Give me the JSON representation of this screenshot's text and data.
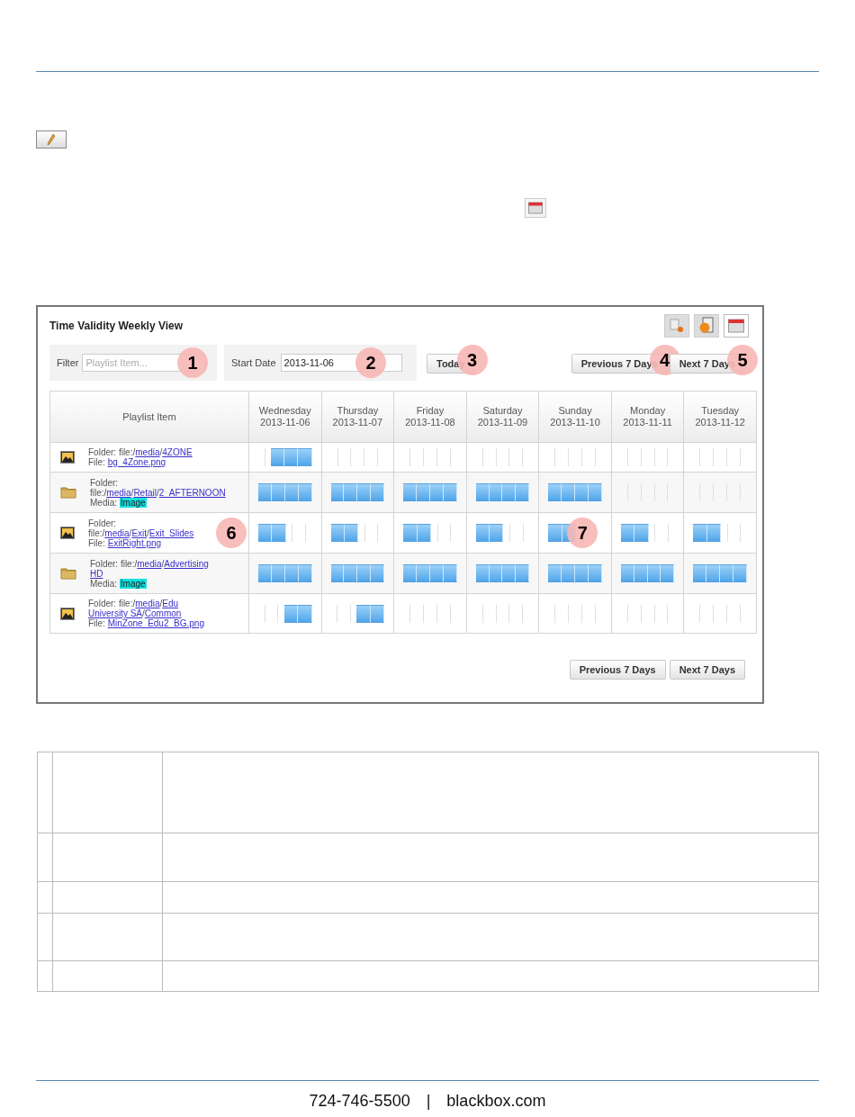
{
  "panel": {
    "title": "Time Validity Weekly View",
    "filter": {
      "label": "Filter",
      "placeholder": "Playlist Item...",
      "callout": "1"
    },
    "start_date": {
      "label": "Start Date",
      "value": "2013-11-06",
      "callout": "2"
    },
    "today_button": {
      "label": "Today",
      "callout": "3"
    },
    "top_nav": [
      {
        "label": "Previous 7 Days",
        "callout": "4"
      },
      {
        "label": "Next 7 Days",
        "callout": "5"
      }
    ],
    "table": {
      "first_column": "Playlist Item",
      "days": [
        {
          "day": "Wednesday",
          "date": "2013-11-06"
        },
        {
          "day": "Thursday",
          "date": "2013-11-07"
        },
        {
          "day": "Friday",
          "date": "2013-11-08"
        },
        {
          "day": "Saturday",
          "date": "2013-11-09"
        },
        {
          "day": "Sunday",
          "date": "2013-11-10"
        },
        {
          "day": "Monday",
          "date": "2013-11-11"
        },
        {
          "day": "Tuesday",
          "date": "2013-11-12"
        }
      ],
      "rows": [
        {
          "kind": "image",
          "lines": [
            [
              {
                "kind": "plain",
                "text": "Folder: file:/"
              },
              {
                "kind": "link",
                "text": "media"
              },
              {
                "kind": "plain",
                "text": "/"
              },
              {
                "kind": "link",
                "text": "4ZONE"
              }
            ],
            [
              {
                "kind": "plain",
                "text": "File: "
              },
              {
                "kind": "link",
                "text": "bg_4Zone.png"
              }
            ]
          ],
          "schedule": [
            {
              "slots": [
                false,
                true,
                true,
                true
              ]
            },
            {
              "slots": [
                false,
                false,
                false,
                false
              ]
            },
            {
              "slots": [
                false,
                false,
                false,
                false
              ]
            },
            {
              "slots": [
                false,
                false,
                false,
                false
              ]
            },
            {
              "slots": [
                false,
                false,
                false,
                false
              ]
            },
            {
              "slots": [
                false,
                false,
                false,
                false
              ]
            },
            {
              "slots": [
                false,
                false,
                false,
                false
              ]
            }
          ]
        },
        {
          "kind": "folder",
          "lines": [
            [
              {
                "kind": "plain",
                "text": "Folder:"
              }
            ],
            [
              {
                "kind": "plain",
                "text": "file:/"
              },
              {
                "kind": "link",
                "text": "media"
              },
              {
                "kind": "plain",
                "text": "/"
              },
              {
                "kind": "link",
                "text": "Retail"
              },
              {
                "kind": "plain",
                "text": "/"
              },
              {
                "kind": "link",
                "text": "2_AFTERNOON"
              }
            ],
            [
              {
                "kind": "plain",
                "text": "Media: "
              },
              {
                "kind": "tag",
                "text": "Image"
              }
            ]
          ],
          "schedule": [
            {
              "slots": [
                true,
                true,
                true,
                true
              ]
            },
            {
              "slots": [
                true,
                true,
                true,
                true
              ]
            },
            {
              "slots": [
                true,
                true,
                true,
                true
              ]
            },
            {
              "slots": [
                true,
                true,
                true,
                true
              ]
            },
            {
              "slots": [
                true,
                true,
                true,
                true
              ]
            },
            {
              "slots": [
                false,
                false,
                false,
                false
              ]
            },
            {
              "slots": [
                false,
                false,
                false,
                false
              ]
            }
          ]
        },
        {
          "kind": "image",
          "callout": "6",
          "lines": [
            [
              {
                "kind": "plain",
                "text": "Folder:"
              }
            ],
            [
              {
                "kind": "plain",
                "text": "file:/"
              },
              {
                "kind": "link",
                "text": "media"
              },
              {
                "kind": "plain",
                "text": "/"
              },
              {
                "kind": "link",
                "text": "Exit"
              },
              {
                "kind": "plain",
                "text": "/"
              },
              {
                "kind": "link",
                "text": "Exit_Slides"
              }
            ],
            [
              {
                "kind": "plain",
                "text": "File: "
              },
              {
                "kind": "link",
                "text": "ExitRight.png"
              }
            ]
          ],
          "schedule": [
            {
              "slots": [
                true,
                true,
                false,
                false
              ]
            },
            {
              "slots": [
                true,
                true,
                false,
                false
              ]
            },
            {
              "slots": [
                true,
                true,
                false,
                false
              ]
            },
            {
              "slots": [
                true,
                true,
                false,
                false
              ]
            },
            {
              "slots": [
                true,
                true,
                false,
                false
              ],
              "callout": "7"
            },
            {
              "slots": [
                true,
                true,
                false,
                false
              ]
            },
            {
              "slots": [
                true,
                true,
                false,
                false
              ]
            }
          ]
        },
        {
          "kind": "folder",
          "lines": [
            [
              {
                "kind": "plain",
                "text": "Folder: file:/"
              },
              {
                "kind": "link",
                "text": "media"
              },
              {
                "kind": "plain",
                "text": "/"
              },
              {
                "kind": "link",
                "text": "Advertising"
              }
            ],
            [
              {
                "kind": "link",
                "text": "HD"
              }
            ],
            [
              {
                "kind": "plain",
                "text": "Media: "
              },
              {
                "kind": "tag",
                "text": "Image"
              }
            ]
          ],
          "schedule": [
            {
              "slots": [
                true,
                true,
                true,
                true
              ]
            },
            {
              "slots": [
                true,
                true,
                true,
                true
              ]
            },
            {
              "slots": [
                true,
                true,
                true,
                true
              ]
            },
            {
              "slots": [
                true,
                true,
                true,
                true
              ]
            },
            {
              "slots": [
                true,
                true,
                true,
                true
              ]
            },
            {
              "slots": [
                true,
                true,
                true,
                true
              ]
            },
            {
              "slots": [
                true,
                true,
                true,
                true
              ]
            }
          ]
        },
        {
          "kind": "image",
          "lines": [
            [
              {
                "kind": "plain",
                "text": "Folder: file:/"
              },
              {
                "kind": "link",
                "text": "media"
              },
              {
                "kind": "plain",
                "text": "/"
              },
              {
                "kind": "link",
                "text": "Edu"
              }
            ],
            [
              {
                "kind": "link",
                "text": "University SA"
              },
              {
                "kind": "plain",
                "text": "/"
              },
              {
                "kind": "link",
                "text": "Common"
              }
            ],
            [
              {
                "kind": "plain",
                "text": "File: "
              },
              {
                "kind": "link",
                "text": "MinZone_Edu2_BG.png"
              }
            ]
          ],
          "schedule": [
            {
              "slots": [
                false,
                false,
                true,
                true
              ]
            },
            {
              "slots": [
                false,
                false,
                true,
                true
              ]
            },
            {
              "slots": [
                false,
                false,
                false,
                false
              ]
            },
            {
              "slots": [
                false,
                false,
                false,
                false
              ]
            },
            {
              "slots": [
                false,
                false,
                false,
                false
              ]
            },
            {
              "slots": [
                false,
                false,
                false,
                false
              ]
            },
            {
              "slots": [
                false,
                false,
                false,
                false
              ]
            }
          ]
        }
      ]
    },
    "bottom_nav": [
      {
        "label": "Previous 7 Days"
      },
      {
        "label": "Next 7 Days"
      }
    ]
  },
  "footer": {
    "phone": "724-746-5500",
    "separator": "|",
    "website": "blackbox.com"
  }
}
